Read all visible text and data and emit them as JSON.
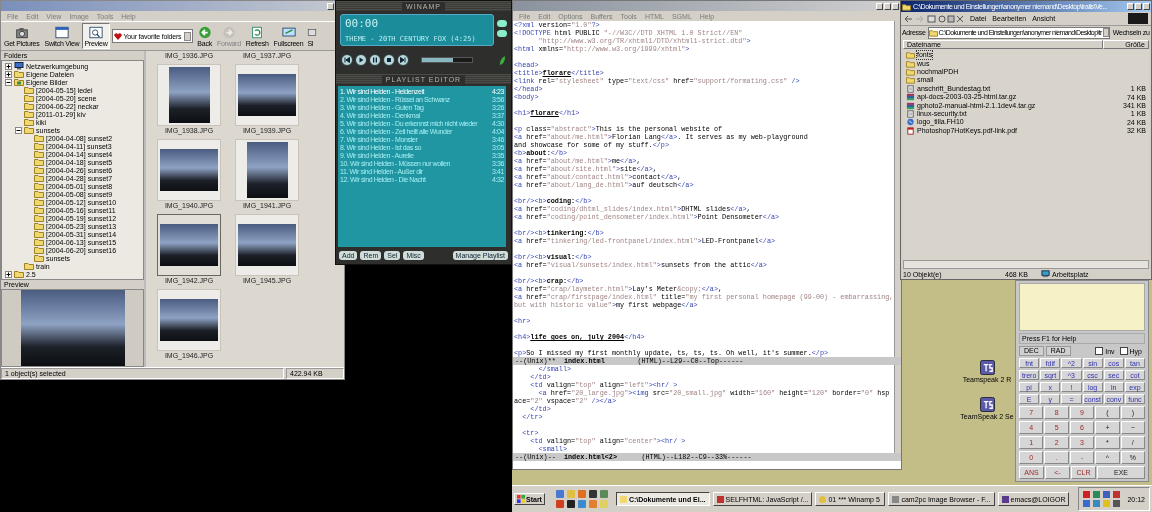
{
  "image_browser": {
    "menu": [
      "File",
      "Edit",
      "View",
      "Image",
      "Tools",
      "Help"
    ],
    "toolbar": [
      {
        "label": "Get Pictures",
        "kind": "camera",
        "selected": false,
        "disabled": false
      },
      {
        "label": "Switch View",
        "kind": "view",
        "selected": false,
        "disabled": false
      },
      {
        "label": "Preview",
        "kind": "preview",
        "selected": true,
        "disabled": false
      },
      {
        "label": "Your favorite folders",
        "kind": "favorites",
        "selected": false,
        "disabled": false
      },
      {
        "label": "Back",
        "kind": "back",
        "selected": false,
        "disabled": false
      },
      {
        "label": "Forward",
        "kind": "forward",
        "selected": false,
        "disabled": true
      },
      {
        "label": "Refresh",
        "kind": "refresh",
        "selected": false,
        "disabled": false
      },
      {
        "label": "Fullscreen",
        "kind": "fullscreen",
        "selected": false,
        "disabled": false
      },
      {
        "label": "Sl",
        "kind": "slideshow",
        "selected": false,
        "disabled": false
      }
    ],
    "folders_title": "Folders",
    "tree": [
      {
        "label": "Netzwerkumgebung",
        "kind": "network",
        "expanded": false
      },
      {
        "label": "Eigene Dateien",
        "kind": "folder",
        "expanded": false
      },
      {
        "label": "Eigene Bilder",
        "kind": "pictures",
        "expanded": true,
        "children": [
          {
            "label": "[2004-05-15] ledei",
            "kind": "folder"
          },
          {
            "label": "[2004-05-20] scene",
            "kind": "folder"
          },
          {
            "label": "[2004-06-22] neckar",
            "kind": "folder"
          },
          {
            "label": "[2011-01-29] kiv",
            "kind": "folder"
          },
          {
            "label": "kiki",
            "kind": "folder"
          },
          {
            "label": "sunsets",
            "kind": "folder",
            "expanded": true,
            "children": [
              {
                "label": "[2004-04-08] sunset2",
                "kind": "folder"
              },
              {
                "label": "[2004-04-11] sunset3",
                "kind": "folder"
              },
              {
                "label": "[2004-04-14] sunset4",
                "kind": "folder"
              },
              {
                "label": "[2004-04-18] sunset5",
                "kind": "folder"
              },
              {
                "label": "[2004-04-26] sunset6",
                "kind": "folder"
              },
              {
                "label": "[2004-04-28] sunset7",
                "kind": "folder"
              },
              {
                "label": "[2004-05-01] sunset8",
                "kind": "folder"
              },
              {
                "label": "[2004-05-08] sunset9",
                "kind": "folder"
              },
              {
                "label": "[2004-05-12] sunset10",
                "kind": "folder"
              },
              {
                "label": "[2004-05-16] sunset11",
                "kind": "folder"
              },
              {
                "label": "[2004-05-19] sunset12",
                "kind": "folder"
              },
              {
                "label": "[2004-05-23] sunset13",
                "kind": "folder"
              },
              {
                "label": "[2004-05-31] sunset14",
                "kind": "folder"
              },
              {
                "label": "[2004-06-13] sunset15",
                "kind": "folder"
              },
              {
                "label": "[2004-06-20] sunset16",
                "kind": "folder"
              },
              {
                "label": "sunsets",
                "kind": "folder"
              }
            ]
          },
          {
            "label": "train",
            "kind": "folder"
          }
        ]
      },
      {
        "label": "2.5",
        "kind": "folder",
        "expanded": false
      }
    ],
    "preview_title": "Preview",
    "cut_labels": [
      "IMG_1936.JPG",
      "IMG_1937.JPG"
    ],
    "thumbnails": [
      {
        "name": "IMG_1938.JPG",
        "kind": "portrait",
        "selected": false
      },
      {
        "name": "IMG_1939.JPG",
        "kind": "landscape",
        "selected": false
      },
      {
        "name": "IMG_1940.JPG",
        "kind": "landscape",
        "selected": false
      },
      {
        "name": "IMG_1941.JPG",
        "kind": "portrait",
        "selected": false
      },
      {
        "name": "IMG_1942.JPG",
        "kind": "landscape",
        "selected": true
      },
      {
        "name": "IMG_1945.JPG",
        "kind": "landscape",
        "selected": false
      },
      {
        "name": "IMG_1946.JPG",
        "kind": "landscape",
        "selected": false
      }
    ],
    "status": [
      "1 object(s) selected",
      "422.94 KB"
    ]
  },
  "winamp": {
    "title": "WINAMP",
    "time": "00:00",
    "ticker": "THEME - 20TH CENTURY FOX (4:25)",
    "volume": {
      "level": 0.62
    },
    "playlist_title": "PLAYLIST EDITOR",
    "tracks": [
      {
        "title": "1. Wir sind Helden - Heldenzeit",
        "time": "4:23",
        "selected": true
      },
      {
        "title": "2. Wir sind Helden - Rüssel an Schwanz",
        "time": "3:56",
        "selected": false
      },
      {
        "title": "3. Wir sind Helden - Guten Tag",
        "time": "3:26",
        "selected": false
      },
      {
        "title": "4. Wir sind Helden - Denkmal",
        "time": "3:37",
        "selected": false
      },
      {
        "title": "5. Wir sind Helden - Du erkennst mich nicht wieder",
        "time": "4:30",
        "selected": false
      },
      {
        "title": "6. Wir sind Helden - Zeit heilt alle Wunder",
        "time": "4:04",
        "selected": false
      },
      {
        "title": "7. Wir sind Helden - Monster",
        "time": "3:46",
        "selected": false
      },
      {
        "title": "8. Wir sind Helden - Ist das so",
        "time": "3:05",
        "selected": false
      },
      {
        "title": "9. Wir sind Helden - Aurelie",
        "time": "3:35",
        "selected": false
      },
      {
        "title": "10. Wir sind Helden - Müssen nur wollen",
        "time": "3:36",
        "selected": false
      },
      {
        "title": "11. Wir sind Helden - Außer dir",
        "time": "3:41",
        "selected": false
      },
      {
        "title": "12. Wir sind Helden - Die Nacht",
        "time": "4:32",
        "selected": false
      }
    ],
    "buttons": [
      "Add",
      "Rem",
      "Sel",
      "Misc",
      "Manage Playlist"
    ]
  },
  "editor": {
    "menu": [
      "File",
      "Edit",
      "Options",
      "Buffers",
      "Tools",
      "HTML",
      "SGML",
      "Help"
    ],
    "top_lines": [
      {
        "kind": "code",
        "segments": [
          {
            "kind": "tag",
            "text": "<?xml"
          },
          {
            "kind": "txt",
            "text": " version="
          },
          {
            "kind": "str",
            "text": "\"1.0\""
          },
          {
            "kind": "tag",
            "text": "?>"
          }
        ]
      },
      {
        "kind": "code",
        "segments": [
          {
            "kind": "tag",
            "text": "<!DOCTYPE"
          },
          {
            "kind": "txt",
            "text": " html PUBLIC "
          },
          {
            "kind": "str",
            "text": "\"-//W3C//DTD XHTML 1.0 Strict//EN\""
          }
        ]
      },
      {
        "kind": "code",
        "segments": [
          {
            "kind": "str",
            "text": "      \"http://www.w3.org/TR/xhtml1/DTD/xhtml1-strict.dtd\""
          },
          {
            "kind": "tag",
            "text": ">"
          }
        ]
      },
      {
        "kind": "code",
        "segments": [
          {
            "kind": "tag",
            "text": "<html"
          },
          {
            "kind": "txt",
            "text": " xmlns="
          },
          {
            "kind": "str",
            "text": "\"http://www.w3.org/1999/xhtml\""
          },
          {
            "kind": "tag",
            "text": ">"
          }
        ]
      },
      {
        "kind": "blank"
      },
      {
        "kind": "code",
        "segments": [
          {
            "kind": "tag",
            "text": "<head>"
          }
        ]
      },
      {
        "kind": "code",
        "segments": [
          {
            "kind": "tag",
            "text": "<title>"
          },
          {
            "kind": "title",
            "text": "florare"
          },
          {
            "kind": "tag",
            "text": "</title>"
          }
        ]
      },
      {
        "kind": "code",
        "segments": [
          {
            "kind": "tag",
            "text": "<link"
          },
          {
            "kind": "txt",
            "text": " rel="
          },
          {
            "kind": "str",
            "text": "\"stylesheet\""
          },
          {
            "kind": "txt",
            "text": " type="
          },
          {
            "kind": "str",
            "text": "\"text/css\""
          },
          {
            "kind": "txt",
            "text": " href="
          },
          {
            "kind": "str",
            "text": "\"support/formating.css\""
          },
          {
            "kind": "tag",
            "text": " />"
          }
        ]
      },
      {
        "kind": "code",
        "segments": [
          {
            "kind": "tag",
            "text": "</head>"
          }
        ]
      },
      {
        "kind": "code",
        "segments": [
          {
            "kind": "tag",
            "text": "<body>"
          }
        ]
      },
      {
        "kind": "blank"
      },
      {
        "kind": "code",
        "segments": [
          {
            "kind": "tag",
            "text": "<h1>"
          },
          {
            "kind": "title",
            "text": "florare"
          },
          {
            "kind": "tag",
            "text": "</h1>"
          }
        ]
      },
      {
        "kind": "blank"
      },
      {
        "kind": "code",
        "segments": [
          {
            "kind": "tag",
            "text": "<p"
          },
          {
            "kind": "txt",
            "text": " class="
          },
          {
            "kind": "str",
            "text": "\"abstract\""
          },
          {
            "kind": "tag",
            "text": ">"
          },
          {
            "kind": "txt",
            "text": "This is the personal website of"
          }
        ]
      },
      {
        "kind": "code",
        "segments": [
          {
            "kind": "tag",
            "text": "<a"
          },
          {
            "kind": "txt",
            "text": " href="
          },
          {
            "kind": "str",
            "text": "\"about/me.html\""
          },
          {
            "kind": "tag",
            "text": ">"
          },
          {
            "kind": "txt",
            "text": "Florian Lang"
          },
          {
            "kind": "tag",
            "text": "</a>"
          },
          {
            "kind": "txt",
            "text": ". It serves as my web-playground"
          }
        ]
      },
      {
        "kind": "code",
        "segments": [
          {
            "kind": "txt",
            "text": "and showcase for some of my stuff."
          },
          {
            "kind": "tag",
            "text": "</p>"
          }
        ]
      },
      {
        "kind": "code",
        "segments": [
          {
            "kind": "tag",
            "text": "<b>"
          },
          {
            "kind": "bold",
            "text": "about:"
          },
          {
            "kind": "tag",
            "text": "</b>"
          }
        ]
      },
      {
        "kind": "code",
        "segments": [
          {
            "kind": "tag",
            "text": "<a"
          },
          {
            "kind": "txt",
            "text": " href="
          },
          {
            "kind": "str",
            "text": "\"about/me.html\""
          },
          {
            "kind": "tag",
            "text": ">"
          },
          {
            "kind": "txt",
            "text": "me"
          },
          {
            "kind": "tag",
            "text": "</a>"
          },
          {
            "kind": "txt",
            "text": ","
          }
        ]
      },
      {
        "kind": "code",
        "segments": [
          {
            "kind": "tag",
            "text": "<a"
          },
          {
            "kind": "txt",
            "text": " href="
          },
          {
            "kind": "str",
            "text": "\"about/site.html\""
          },
          {
            "kind": "tag",
            "text": ">"
          },
          {
            "kind": "txt",
            "text": "site"
          },
          {
            "kind": "tag",
            "text": "</a>"
          },
          {
            "kind": "txt",
            "text": ","
          }
        ]
      },
      {
        "kind": "code",
        "segments": [
          {
            "kind": "tag",
            "text": "<a"
          },
          {
            "kind": "txt",
            "text": " href="
          },
          {
            "kind": "str",
            "text": "\"about/contact.html\""
          },
          {
            "kind": "tag",
            "text": ">"
          },
          {
            "kind": "txt",
            "text": "contact"
          },
          {
            "kind": "tag",
            "text": "</a>"
          },
          {
            "kind": "txt",
            "text": ","
          }
        ]
      },
      {
        "kind": "code",
        "segments": [
          {
            "kind": "tag",
            "text": "<a"
          },
          {
            "kind": "txt",
            "text": " href="
          },
          {
            "kind": "str",
            "text": "\"about/lang_de.html\""
          },
          {
            "kind": "tag",
            "text": ">"
          },
          {
            "kind": "txt",
            "text": "auf deutsch"
          },
          {
            "kind": "tag",
            "text": "</a>"
          }
        ]
      },
      {
        "kind": "blank"
      },
      {
        "kind": "code",
        "segments": [
          {
            "kind": "tag",
            "text": "<br/><b>"
          },
          {
            "kind": "bold",
            "text": "coding:"
          },
          {
            "kind": "tag",
            "text": "</b>"
          }
        ]
      },
      {
        "kind": "code",
        "segments": [
          {
            "kind": "tag",
            "text": "<a"
          },
          {
            "kind": "txt",
            "text": " href="
          },
          {
            "kind": "str",
            "text": "\"coding/dhtml_slides/index.html\""
          },
          {
            "kind": "tag",
            "text": ">"
          },
          {
            "kind": "txt",
            "text": "DHTML slides"
          },
          {
            "kind": "tag",
            "text": "</a>"
          },
          {
            "kind": "txt",
            "text": ","
          }
        ]
      },
      {
        "kind": "code",
        "segments": [
          {
            "kind": "tag",
            "text": "<a"
          },
          {
            "kind": "txt",
            "text": " href="
          },
          {
            "kind": "str",
            "text": "\"coding/point_densometer/index.html\""
          },
          {
            "kind": "tag",
            "text": ">"
          },
          {
            "kind": "txt",
            "text": "Point Densometer"
          },
          {
            "kind": "tag",
            "text": "</a>"
          }
        ]
      },
      {
        "kind": "blank"
      },
      {
        "kind": "code",
        "segments": [
          {
            "kind": "tag",
            "text": "<br/><b>"
          },
          {
            "kind": "bold",
            "text": "tinkering:"
          },
          {
            "kind": "tag",
            "text": "</b>"
          }
        ]
      },
      {
        "kind": "code",
        "segments": [
          {
            "kind": "tag",
            "text": "<a"
          },
          {
            "kind": "txt",
            "text": " href="
          },
          {
            "kind": "str",
            "text": "\"tinkering/led-frontpanel/index.html\""
          },
          {
            "kind": "tag",
            "text": ">"
          },
          {
            "kind": "txt",
            "text": "LED-Frontpanel"
          },
          {
            "kind": "tag",
            "text": "</a>"
          }
        ]
      },
      {
        "kind": "blank"
      },
      {
        "kind": "code",
        "segments": [
          {
            "kind": "tag",
            "text": "<br/><b>"
          },
          {
            "kind": "bold",
            "text": "visual:"
          },
          {
            "kind": "tag",
            "text": "</b>"
          }
        ]
      },
      {
        "kind": "code",
        "segments": [
          {
            "kind": "tag",
            "text": "<a"
          },
          {
            "kind": "txt",
            "text": " href="
          },
          {
            "kind": "str",
            "text": "\"visual/sunsets/index.html\""
          },
          {
            "kind": "tag",
            "text": ">"
          },
          {
            "kind": "txt",
            "text": "sunsets from the attic"
          },
          {
            "kind": "tag",
            "text": "</a>"
          }
        ]
      },
      {
        "kind": "blank"
      },
      {
        "kind": "code",
        "segments": [
          {
            "kind": "tag",
            "text": "<br/><b>"
          },
          {
            "kind": "bold",
            "text": "crap:"
          },
          {
            "kind": "tag",
            "text": "</b>"
          }
        ]
      },
      {
        "kind": "code",
        "segments": [
          {
            "kind": "tag",
            "text": "<a"
          },
          {
            "kind": "txt",
            "text": " href="
          },
          {
            "kind": "str",
            "text": "\"crap/laymeter.html\""
          },
          {
            "kind": "tag",
            "text": ">"
          },
          {
            "kind": "txt",
            "text": "Lay's Meter"
          },
          {
            "kind": "str",
            "text": "&copy;"
          },
          {
            "kind": "tag",
            "text": "</a>"
          },
          {
            "kind": "txt",
            "text": ","
          }
        ]
      },
      {
        "kind": "code",
        "segments": [
          {
            "kind": "tag",
            "text": "<a"
          },
          {
            "kind": "txt",
            "text": " href="
          },
          {
            "kind": "str",
            "text": "\"crap/firstpage/index.html\""
          },
          {
            "kind": "txt",
            "text": " title="
          },
          {
            "kind": "str",
            "text": "\"my first personal homepage (99-00) - embarrassing,"
          }
        ]
      },
      {
        "kind": "code",
        "segments": [
          {
            "kind": "str",
            "text": "but with historic value\""
          },
          {
            "kind": "tag",
            "text": ">"
          },
          {
            "kind": "txt",
            "text": "my first webpage"
          },
          {
            "kind": "tag",
            "text": "</a>"
          }
        ]
      },
      {
        "kind": "blank"
      },
      {
        "kind": "code",
        "segments": [
          {
            "kind": "tag",
            "text": "<hr>"
          }
        ]
      },
      {
        "kind": "blank"
      },
      {
        "kind": "code",
        "segments": [
          {
            "kind": "tag",
            "text": "<h4>"
          },
          {
            "kind": "title",
            "text": "life goes on, july 2004"
          },
          {
            "kind": "tag",
            "text": "</h4>"
          }
        ]
      },
      {
        "kind": "blank"
      },
      {
        "kind": "code",
        "segments": [
          {
            "kind": "tag",
            "text": "<p>"
          },
          {
            "kind": "txt",
            "text": "So I missed my first monthly update, ts, ts, ts. Oh well, it's summer."
          },
          {
            "kind": "tag",
            "text": "</p>"
          }
        ]
      }
    ],
    "mode_line_1": "--(Unix)**  **index.html**        (HTML)--L29--C0--Top------",
    "bottom_lines": [
      {
        "kind": "code",
        "segments": [
          {
            "kind": "tag",
            "text": "      </small>"
          }
        ]
      },
      {
        "kind": "code",
        "segments": [
          {
            "kind": "tag",
            "text": "    </td>"
          }
        ]
      },
      {
        "kind": "code",
        "segments": [
          {
            "kind": "tag",
            "text": "    <td"
          },
          {
            "kind": "txt",
            "text": " valign="
          },
          {
            "kind": "str",
            "text": "\"top\""
          },
          {
            "kind": "txt",
            "text": " align="
          },
          {
            "kind": "str",
            "text": "\"left\""
          },
          {
            "kind": "tag",
            "text": "><hr/ >"
          }
        ]
      },
      {
        "kind": "code",
        "segments": [
          {
            "kind": "tag",
            "text": "      <a"
          },
          {
            "kind": "txt",
            "text": " href="
          },
          {
            "kind": "str",
            "text": "\"20_large.jpg\""
          },
          {
            "kind": "tag",
            "text": "><img"
          },
          {
            "kind": "txt",
            "text": " src="
          },
          {
            "kind": "str",
            "text": "\"20_small.jpg\""
          },
          {
            "kind": "txt",
            "text": " width="
          },
          {
            "kind": "str",
            "text": "\"160\""
          },
          {
            "kind": "txt",
            "text": " height="
          },
          {
            "kind": "str",
            "text": "\"120\""
          },
          {
            "kind": "txt",
            "text": " border="
          },
          {
            "kind": "str",
            "text": "\"0\""
          },
          {
            "kind": "txt",
            "text": " hsp"
          }
        ]
      },
      {
        "kind": "code",
        "segments": [
          {
            "kind": "txt",
            "text": "ace="
          },
          {
            "kind": "str",
            "text": "\"2\""
          },
          {
            "kind": "txt",
            "text": " vspace="
          },
          {
            "kind": "str",
            "text": "\"2\""
          },
          {
            "kind": "tag",
            "text": " /></a>"
          }
        ]
      },
      {
        "kind": "code",
        "segments": [
          {
            "kind": "tag",
            "text": "    </td>"
          }
        ]
      },
      {
        "kind": "code",
        "segments": [
          {
            "kind": "tag",
            "text": "  </tr>"
          }
        ]
      },
      {
        "kind": "blank"
      },
      {
        "kind": "code",
        "segments": [
          {
            "kind": "tag",
            "text": "  <tr>"
          }
        ]
      },
      {
        "kind": "code",
        "segments": [
          {
            "kind": "tag",
            "text": "    <td"
          },
          {
            "kind": "txt",
            "text": " valign="
          },
          {
            "kind": "str",
            "text": "\"top\""
          },
          {
            "kind": "txt",
            "text": " align="
          },
          {
            "kind": "str",
            "text": "\"center\""
          },
          {
            "kind": "tag",
            "text": "><hr/ >"
          }
        ]
      },
      {
        "kind": "code",
        "segments": [
          {
            "kind": "tag",
            "text": "      <small>"
          }
        ]
      }
    ],
    "mode_line_2": "--(Unix)--  **index.html<2>**      (HTML)--L182--C9--33%------"
  },
  "explorer": {
    "title": "C:\\Dokumente und Einstellungen\\anonymer niemand\\Desktop\\trails\\Ve...",
    "menu": [
      "Datei",
      "Bearbeiten",
      "Ansicht"
    ],
    "address_label": "Adresse",
    "address": "C:\\Dokumente und Einstellungen\\anonymer niemand\\Desktop\\tr",
    "go": "Wechseln zu",
    "columns": [
      "Dateiname",
      "Größe"
    ],
    "files": [
      {
        "name": "fonts",
        "kind": "folder",
        "selected": true
      },
      {
        "name": "wus",
        "kind": "folder",
        "selected": false
      },
      {
        "name": "nochmalPDH",
        "kind": "folder",
        "selected": false
      },
      {
        "name": "small",
        "kind": "folder",
        "selected": false
      },
      {
        "name": "anschrift_Bundestag.txt",
        "size": "1 KB",
        "kind": "text",
        "selected": false
      },
      {
        "name": "api-docs-2003-03-25-html.tar.gz",
        "size": "74 KB",
        "kind": "archive",
        "selected": false
      },
      {
        "name": "gphoto2-manual-html-2.1.1dev4.tar.gz",
        "size": "341 KB",
        "kind": "archive",
        "selected": false
      },
      {
        "name": "linux-security.txt",
        "size": "1 KB",
        "kind": "text",
        "selected": false
      },
      {
        "name": "logo_tilla.FH10",
        "size": "24 KB",
        "kind": "drawing",
        "selected": false
      },
      {
        "name": "Photoshop7HotKeys.pdf-link.pdf",
        "size": "32 KB",
        "kind": "pdf",
        "selected": false
      }
    ],
    "status": [
      "10 Objekt(e)",
      "468 KB",
      "Arbeitsplatz"
    ]
  },
  "desktop_icons": [
    "Teamspeak 2 R",
    "TeamSpeak 2 Se"
  ],
  "calculator": {
    "help": "Press F1 for Help",
    "modes": [
      "DEC",
      "RAD"
    ],
    "checks": [
      {
        "label": "Inv",
        "checked": false
      },
      {
        "label": "Hyp",
        "checked": false
      }
    ],
    "rows": [
      [
        {
          "label": "fnt",
          "kind": "fn"
        },
        {
          "label": "fdif",
          "kind": "fn"
        },
        {
          "label": "^2",
          "kind": "fn"
        },
        {
          "label": "sin",
          "kind": "fn"
        },
        {
          "label": "cos",
          "kind": "fn"
        },
        {
          "label": "tan",
          "kind": "fn"
        }
      ],
      [
        {
          "label": "trero",
          "kind": "fn"
        },
        {
          "label": "sqrt",
          "kind": "fn"
        },
        {
          "label": "^3",
          "kind": "fn"
        },
        {
          "label": "csc",
          "kind": "fn"
        },
        {
          "label": "sec",
          "kind": "fn"
        },
        {
          "label": "cot",
          "kind": "fn"
        }
      ],
      [
        {
          "label": "pi",
          "kind": "fn"
        },
        {
          "label": "x",
          "kind": "fn"
        },
        {
          "label": "!",
          "kind": "fn"
        },
        {
          "label": "log",
          "kind": "fn"
        },
        {
          "label": "ln",
          "kind": "fn"
        },
        {
          "label": "exp",
          "kind": "fn"
        }
      ],
      [
        {
          "label": "E",
          "kind": "fn"
        },
        {
          "label": "y",
          "kind": "fn"
        },
        {
          "label": "=",
          "kind": "fn"
        },
        {
          "label": "const",
          "kind": "fn"
        },
        {
          "label": "conv",
          "kind": "fn"
        },
        {
          "label": "func",
          "kind": "fn"
        }
      ],
      [
        {
          "label": "7",
          "kind": "num"
        },
        {
          "label": "8",
          "kind": "num"
        },
        {
          "label": "9",
          "kind": "num"
        },
        {
          "label": "(",
          "kind": "op"
        },
        {
          "label": ")",
          "kind": "op"
        }
      ],
      [
        {
          "label": "4",
          "kind": "num"
        },
        {
          "label": "5",
          "kind": "num"
        },
        {
          "label": "6",
          "kind": "num"
        },
        {
          "label": "+",
          "kind": "op"
        },
        {
          "label": "−",
          "kind": "op"
        }
      ],
      [
        {
          "label": "1",
          "kind": "num"
        },
        {
          "label": "2",
          "kind": "num"
        },
        {
          "label": "3",
          "kind": "num"
        },
        {
          "label": "*",
          "kind": "op"
        },
        {
          "label": "/",
          "kind": "op"
        }
      ],
      [
        {
          "label": "0",
          "kind": "num"
        },
        {
          "label": ".",
          "kind": "num"
        },
        {
          "label": "-",
          "kind": "num"
        },
        {
          "label": "^",
          "kind": "op"
        },
        {
          "label": "%",
          "kind": "op"
        }
      ],
      [
        {
          "label": "ANS",
          "kind": "num"
        },
        {
          "label": "<-",
          "kind": "num"
        },
        {
          "label": "CLR",
          "kind": "num"
        },
        {
          "label": "EXE",
          "kind": "wide"
        }
      ]
    ]
  },
  "taskbar": {
    "start": "Start",
    "tasks": [
      {
        "label": "C:\\Dokumente und Ei...",
        "kind": "folder",
        "selected": true
      },
      {
        "label": "SELFHTML: JavaScript /...",
        "kind": "browser",
        "selected": false
      },
      {
        "label": "01 *** Winamp 5",
        "kind": "winamp",
        "selected": false
      },
      {
        "label": "cam2pc Image Browser - F...",
        "kind": "camera",
        "selected": false
      },
      {
        "label": "emacs@LOIGOR",
        "kind": "emacs",
        "selected": false
      }
    ],
    "clock": "20:12"
  }
}
